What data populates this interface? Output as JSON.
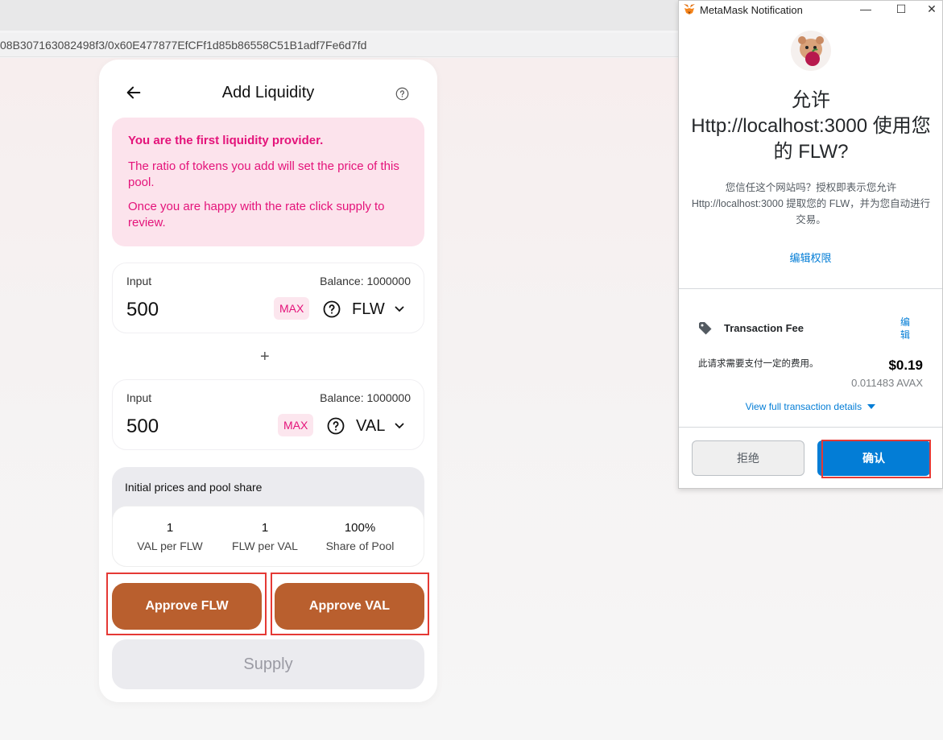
{
  "browser": {
    "url": "08B307163082498f3/0x60E477877EfCFf1d85b86558C51B1adf7Fe6d7fd"
  },
  "card": {
    "title": "Add Liquidity",
    "notice": {
      "title": "You are the first liquidity provider.",
      "text1": "The ratio of tokens you add will set the price of this pool.",
      "text2": "Once you are happy with the rate click supply to review."
    },
    "inputs": [
      {
        "label": "Input",
        "balance": "Balance: 1000000",
        "value": "500",
        "max": "MAX",
        "token": "FLW"
      },
      {
        "label": "Input",
        "balance": "Balance: 1000000",
        "value": "500",
        "max": "MAX",
        "token": "VAL"
      }
    ],
    "plus": "+",
    "prices": {
      "title": "Initial prices and pool share",
      "items": [
        {
          "value": "1",
          "label": "VAL per FLW"
        },
        {
          "value": "1",
          "label": "FLW per VAL"
        },
        {
          "value": "100%",
          "label": "Share of Pool"
        }
      ]
    },
    "approve_flw": "Approve FLW",
    "approve_val": "Approve VAL",
    "supply": "Supply",
    "accent_color": "#b95f2e",
    "notice_color": "#e4137a"
  },
  "metamask": {
    "window_title": "MetaMask Notification",
    "heading_line1": "允许",
    "heading_line2": "Http://localhost:3000 使用您的 FLW?",
    "description": "您信任这个网站吗？授权即表示您允许 Http://localhost:3000 提取您的 FLW，并为您自动进行交易。",
    "edit_permission": "编辑权限",
    "fee_label": "Transaction Fee",
    "fee_edit": "编辑",
    "fee_note": "此请求需要支付一定的费用。",
    "fee_usd": "$0.19",
    "fee_avax": "0.011483 AVAX",
    "view_details": "View full transaction details",
    "reject": "拒绝",
    "confirm": "确认",
    "window_controls": {
      "minimize": "—",
      "maximize": "☐",
      "close": "✕"
    },
    "link_color": "#037dd6"
  }
}
